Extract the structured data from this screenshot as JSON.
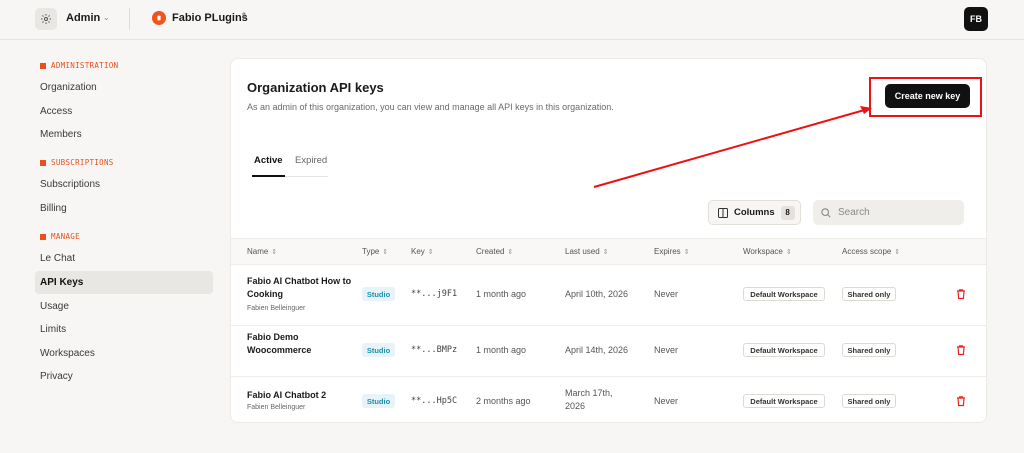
{
  "topbar": {
    "workspace": "Admin",
    "org": "Fabio PLugins",
    "avatar_initials": "FB"
  },
  "sidebar": {
    "sections": [
      {
        "title": "ADMINISTRATION",
        "items": [
          "Organization",
          "Access",
          "Members"
        ]
      },
      {
        "title": "SUBSCRIPTIONS",
        "items": [
          "Subscriptions",
          "Billing"
        ]
      },
      {
        "title": "MANAGE",
        "items": [
          "Le Chat",
          "API Keys",
          "Usage",
          "Limits",
          "Workspaces",
          "Privacy"
        ]
      }
    ],
    "active": "API Keys"
  },
  "page": {
    "title": "Organization API keys",
    "description": "As an admin of this organization, you can view and manage all API keys in this organization.",
    "create_label": "Create new key",
    "tabs": [
      "Active",
      "Expired"
    ],
    "columns_label": "Columns",
    "columns_count": "8",
    "search_placeholder": "Search"
  },
  "table": {
    "headers": [
      "Name",
      "Type",
      "Key",
      "Created",
      "Last used",
      "Expires",
      "Workspace",
      "Access scope"
    ],
    "rows": [
      {
        "name": "Fabio AI Chatbot How to Cooking",
        "owner": "Fabien Belleinguer",
        "type": "Studio",
        "key": "**...j9F1",
        "created": "1 month ago",
        "last_used": "April 10th, 2026",
        "expires": "Never",
        "workspace": "Default Workspace",
        "scope": "Shared only"
      },
      {
        "name": "Fabio Demo Woocommerce",
        "owner": "",
        "type": "Studio",
        "key": "**...BMPz",
        "created": "1 month ago",
        "last_used": "April 14th, 2026",
        "expires": "Never",
        "workspace": "Default Workspace",
        "scope": "Shared only"
      },
      {
        "name": "Fabio AI Chatbot 2",
        "owner": "Fabien Belleinguer",
        "type": "Studio",
        "key": "**...Hp5C",
        "created": "2 months ago",
        "last_used": "March 17th, 2026",
        "expires": "Never",
        "workspace": "Default Workspace",
        "scope": "Shared only"
      }
    ]
  },
  "colors": {
    "accent": "#e8501c",
    "annotation": "#ee1111",
    "primary_button": "#111111",
    "studio_badge": "#1f8fae"
  }
}
